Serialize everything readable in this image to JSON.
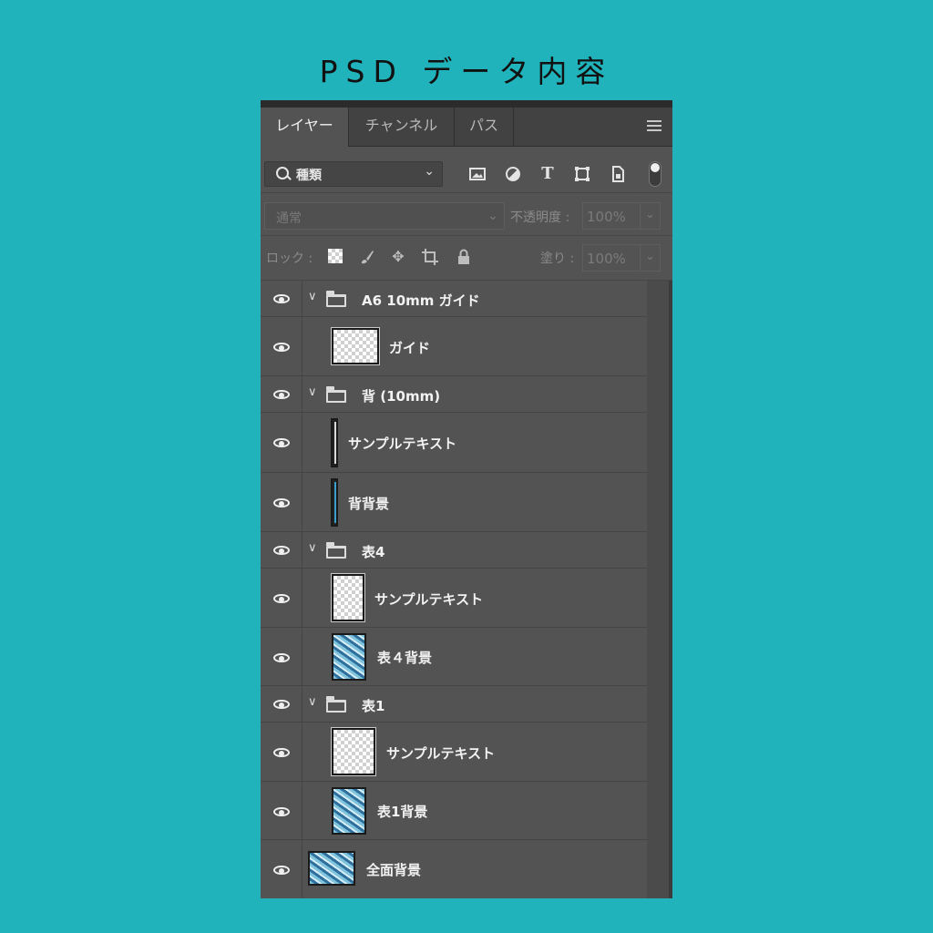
{
  "page_title": "PSD データ内容",
  "panel": {
    "tabs": [
      "レイヤー",
      "チャンネル",
      "パス"
    ],
    "active_tab": "レイヤー",
    "filter": {
      "label": "種類"
    },
    "blend_mode": "通常",
    "opacity_label": "不透明度 :",
    "opacity_value": "100%",
    "lock_label": "ロック :",
    "fill_label": "塗り :",
    "fill_value": "100%"
  },
  "layers": [
    {
      "name": "A6 10mm ガイド",
      "type": "group"
    },
    {
      "name": "ガイド",
      "type": "layer",
      "thumb": "transparent"
    },
    {
      "name": "背 (10mm)",
      "type": "group"
    },
    {
      "name": "サンプルテキスト",
      "type": "layer",
      "thumb": "slim"
    },
    {
      "name": "背背景",
      "type": "layer",
      "thumb": "slim-blue"
    },
    {
      "name": "表4",
      "type": "group"
    },
    {
      "name": "サンプルテキスト",
      "type": "layer",
      "thumb": "transparent"
    },
    {
      "name": "表４背景",
      "type": "layer",
      "thumb": "blue"
    },
    {
      "name": "表1",
      "type": "group"
    },
    {
      "name": "サンプルテキスト",
      "type": "layer",
      "thumb": "transparent"
    },
    {
      "name": "表1背景",
      "type": "layer",
      "thumb": "blue"
    },
    {
      "name": "全面背景",
      "type": "layer",
      "thumb": "blue-wide"
    }
  ]
}
